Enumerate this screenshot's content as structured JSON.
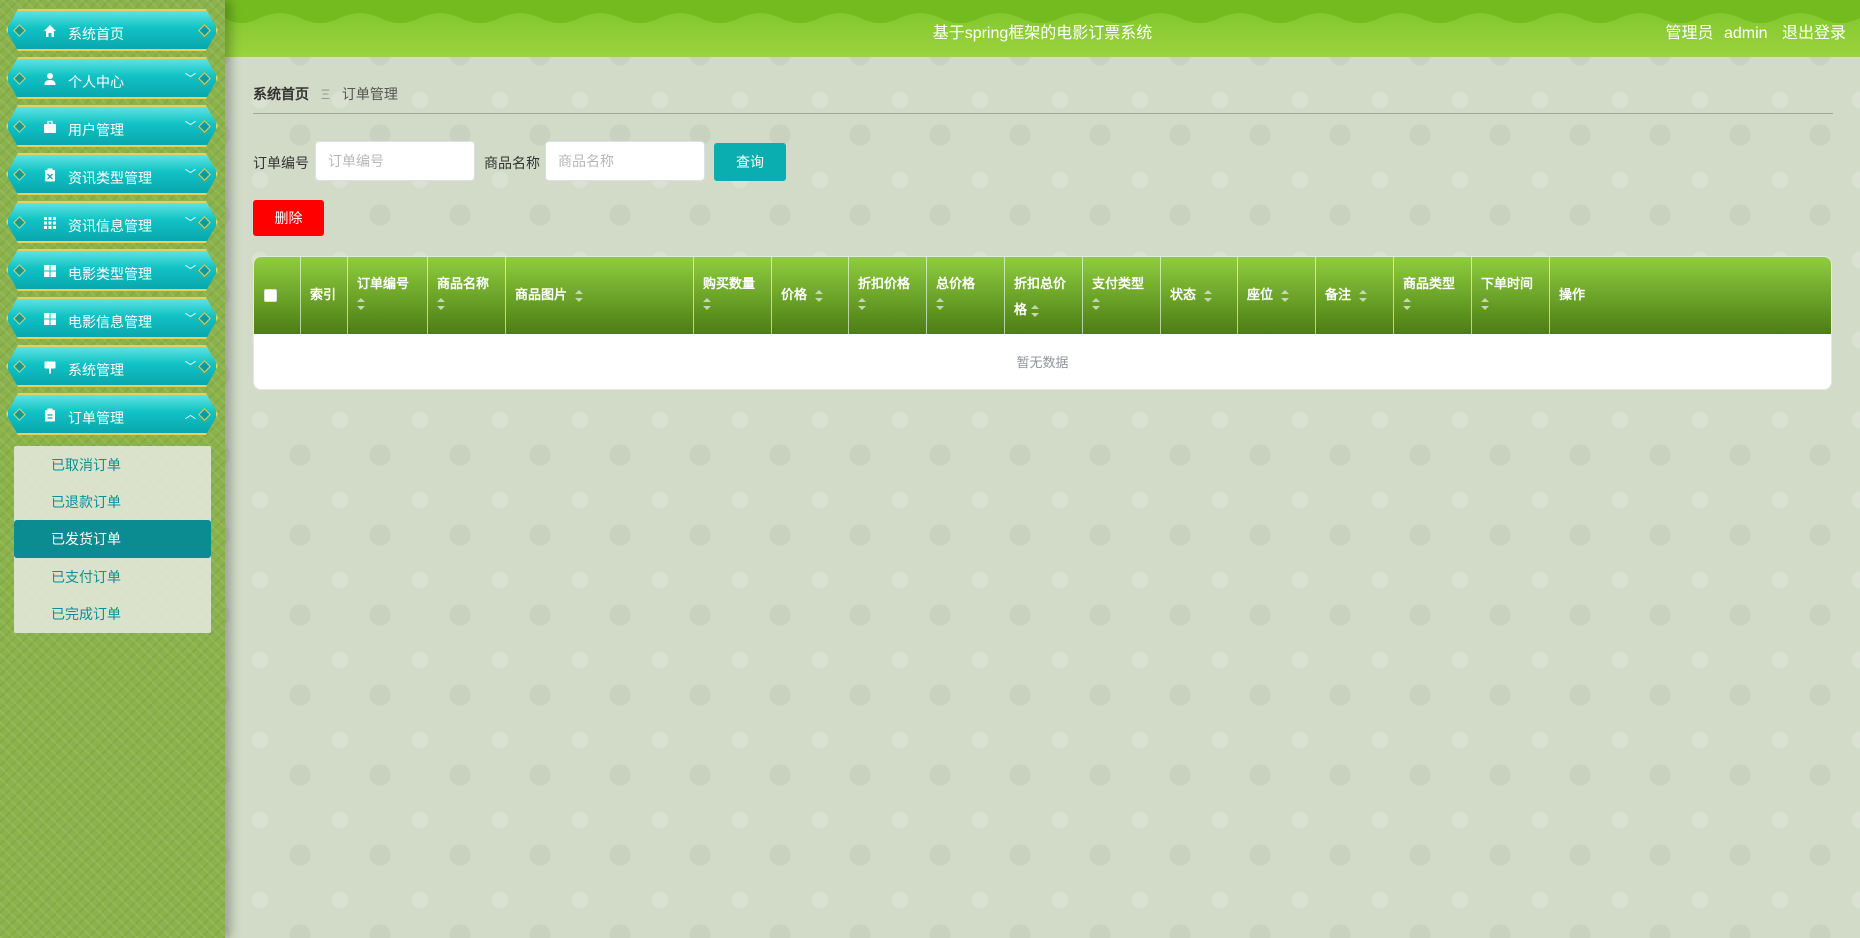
{
  "header": {
    "title": "基于spring框架的电影订票系统",
    "user_role": "管理员",
    "user_name": "admin",
    "logout": "退出登录"
  },
  "sidebar": {
    "items": [
      {
        "label": "系统首页",
        "icon": "home-icon",
        "expandable": false
      },
      {
        "label": "个人中心",
        "icon": "user-icon",
        "expandable": true
      },
      {
        "label": "用户管理",
        "icon": "briefcase-icon",
        "expandable": true
      },
      {
        "label": "资讯类型管理",
        "icon": "clipboard-icon",
        "expandable": true
      },
      {
        "label": "资讯信息管理",
        "icon": "grid-icon",
        "expandable": true
      },
      {
        "label": "电影类型管理",
        "icon": "tiles-icon",
        "expandable": true
      },
      {
        "label": "电影信息管理",
        "icon": "tiles-icon",
        "expandable": true
      },
      {
        "label": "系统管理",
        "icon": "signboard-icon",
        "expandable": true
      },
      {
        "label": "订单管理",
        "icon": "document-icon",
        "expandable": true,
        "expanded": true
      }
    ],
    "submenu": [
      "已取消订单",
      "已退款订单",
      "已发货订单",
      "已支付订单",
      "已完成订单"
    ],
    "active_submenu": "已发货订单"
  },
  "breadcrumb": {
    "home": "系统首页",
    "separator": "Ξ",
    "current": "订单管理"
  },
  "search": {
    "order_no_label": "订单编号",
    "order_no_placeholder": "订单编号",
    "order_no_value": "",
    "product_label": "商品名称",
    "product_placeholder": "商品名称",
    "product_value": "",
    "query_button": "查询"
  },
  "actions": {
    "delete_button": "删除"
  },
  "table": {
    "columns": [
      "索引",
      "订单编号",
      "商品名称",
      "商品图片",
      "购买数量",
      "价格",
      "折扣价格",
      "总价格",
      "折扣总价格",
      "支付类型",
      "状态",
      "座位",
      "备注",
      "商品类型",
      "下单时间",
      "操作"
    ],
    "rows": [],
    "empty_text": "暂无数据"
  },
  "colors": {
    "header_green": "#8cc63f",
    "menu_teal": "#10c2c4",
    "menu_border_gold": "#e9cf5d",
    "active_submenu": "#0b8c90",
    "query_button": "#0aaeb0",
    "delete_button": "#ff0000",
    "table_header_green": "#6aa128"
  }
}
